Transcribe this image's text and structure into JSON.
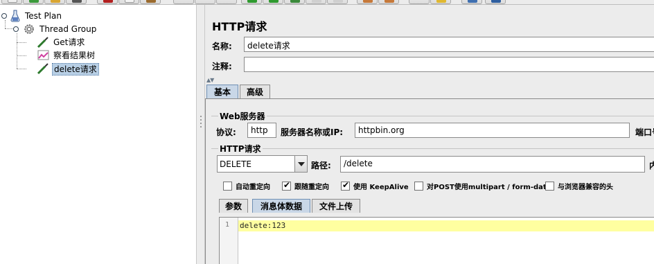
{
  "tree": {
    "items": [
      {
        "label": "Test Plan"
      },
      {
        "label": "Thread Group"
      },
      {
        "label": "Get请求"
      },
      {
        "label": "察看结果树"
      },
      {
        "label": "delete请求"
      }
    ]
  },
  "panel": {
    "title": "HTTP请求",
    "name_label": "名称:",
    "name_value": "delete请求",
    "comment_label": "注释:",
    "comment_value": ""
  },
  "tabs": {
    "basic": "基本",
    "advanced": "高级"
  },
  "web_server": {
    "group_title": "Web服务器",
    "protocol_label": "协议:",
    "protocol_value": "http",
    "host_label": "服务器名称或IP:",
    "host_value": "httpbin.org",
    "port_label": "端口号:"
  },
  "http_request": {
    "group_title": "HTTP请求",
    "method": "DELETE",
    "path_label": "路径:",
    "path_value": "/delete",
    "encoding_label": "内"
  },
  "options": [
    {
      "label": "自动重定向",
      "checked": false
    },
    {
      "label": "跟随重定向",
      "checked": true
    },
    {
      "label": "使用 KeepAlive",
      "checked": true
    },
    {
      "label": "对POST使用multipart / form-data",
      "checked": false
    },
    {
      "label": "与浏览器兼容的头",
      "checked": false
    }
  ],
  "subtabs": [
    "参数",
    "消息体数据",
    "文件上传"
  ],
  "editor": {
    "line_number": "1",
    "code": "delete:123"
  },
  "colors": {
    "selection": "#b8cfe5",
    "active_tab": "#c9d7e7",
    "highlight_line": "#ffffa0"
  }
}
